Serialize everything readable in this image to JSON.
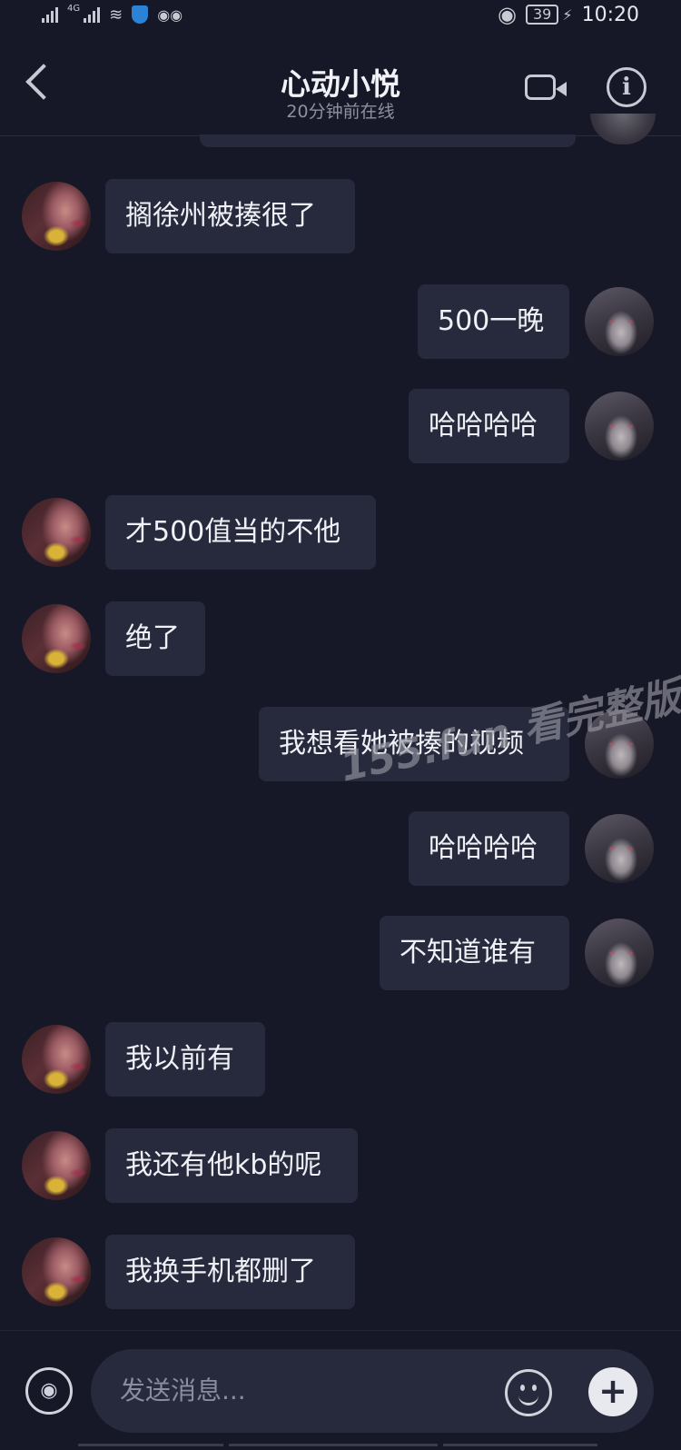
{
  "status_bar": {
    "network": "4G",
    "battery": "39",
    "time": "10:20"
  },
  "header": {
    "title": "心动小悦",
    "subtitle": "20分钟前在线"
  },
  "messages": [
    {
      "side": "left",
      "text": "搁徐州被揍很了"
    },
    {
      "side": "right",
      "text": "500一晚"
    },
    {
      "side": "right",
      "text": "哈哈哈哈"
    },
    {
      "side": "left",
      "text": "才500值当的不他"
    },
    {
      "side": "left",
      "text": "绝了"
    },
    {
      "side": "right",
      "text": "我想看她被揍的视频"
    },
    {
      "side": "right",
      "text": "哈哈哈哈"
    },
    {
      "side": "right",
      "text": "不知道谁有"
    },
    {
      "side": "left",
      "text": "我以前有"
    },
    {
      "side": "left",
      "text": "我还有他kb的呢"
    },
    {
      "side": "left",
      "text": "我换手机都删了"
    }
  ],
  "watermark": "155.fun 看完整版",
  "composer": {
    "placeholder": "发送消息..."
  },
  "icons": {
    "back": "chevron-left-icon",
    "video": "video-camera-icon",
    "info": "info-icon",
    "voice": "voice-icon",
    "emoji": "emoji-icon",
    "plus": "plus-icon"
  },
  "colors": {
    "background": "#161827",
    "bubble": "#262a3c",
    "text": "#f0f1f6",
    "secondary_text": "#8e90a2"
  }
}
